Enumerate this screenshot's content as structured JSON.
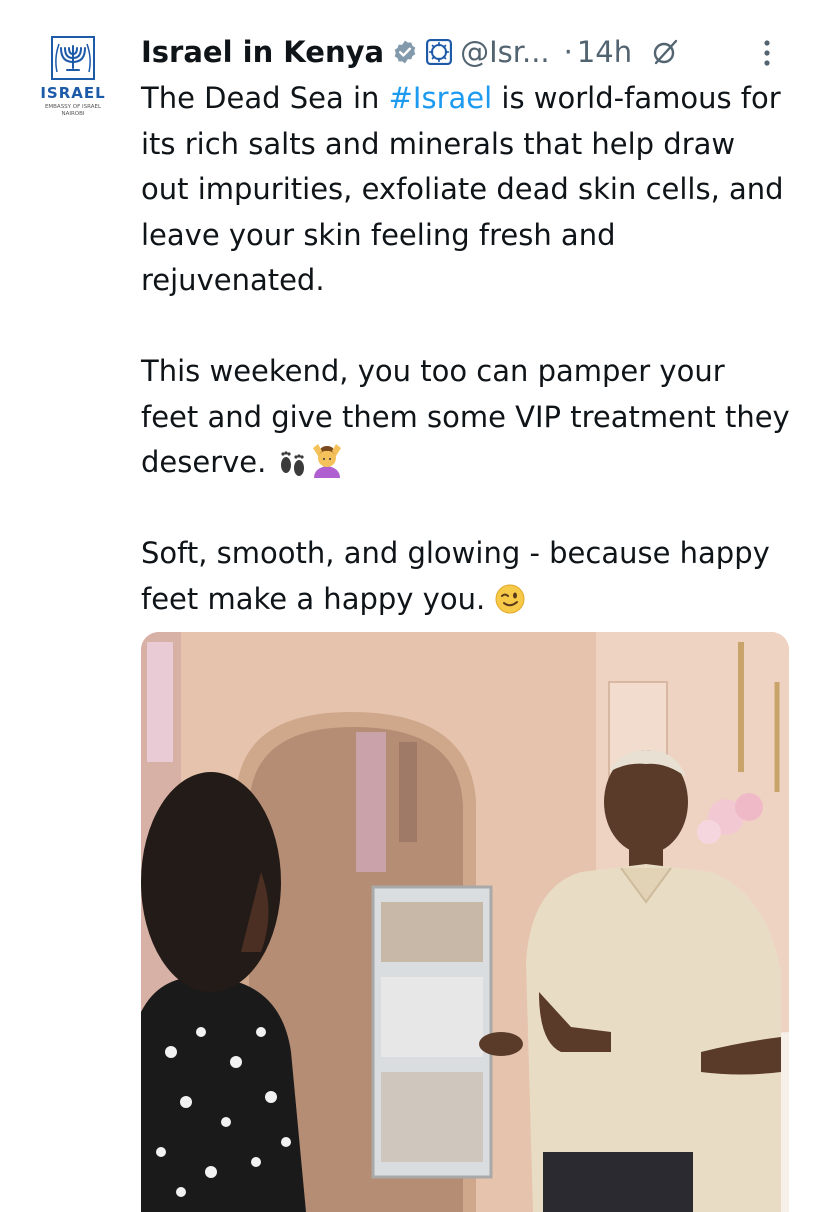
{
  "avatar": {
    "logo_text": "ISRAEL",
    "logo_subtext_line1": "EMBASSY OF ISRAEL",
    "logo_subtext_line2": "NAIROBI",
    "icon": "menorah-emblem-icon"
  },
  "header": {
    "display_name": "Israel in Kenya",
    "verified_icon": "verified-badge-icon",
    "affiliation_icon": "government-affiliate-icon",
    "handle": "@Isr...",
    "separator": "·",
    "time": "14h",
    "grok_icon": "grok-icon",
    "more_icon": "more-vertical-icon"
  },
  "tweet": {
    "p1_before": "The Dead Sea in ",
    "p1_hashtag": "#Israel",
    "p1_after": " is world-famous for its rich salts and minerals that help draw out impurities, exfoliate dead skin cells, and leave your skin feeling fresh and rejuvenated.",
    "p2": "This weekend, you too can pamper your feet and give them some VIP treatment they deserve.",
    "p2_emojis": [
      "footprints-emoji",
      "woman-getting-massage-emoji"
    ],
    "p3": "Soft, smooth, and glowing - because happy feet make a happy you.",
    "p3_emoji": "winking-face-emoji"
  },
  "media": {
    "type": "video-still",
    "scene": "spa-interior"
  },
  "colors": {
    "text": "#0f1419",
    "secondary": "#536471",
    "link": "#1d9bf0",
    "verified": "#829aab"
  }
}
